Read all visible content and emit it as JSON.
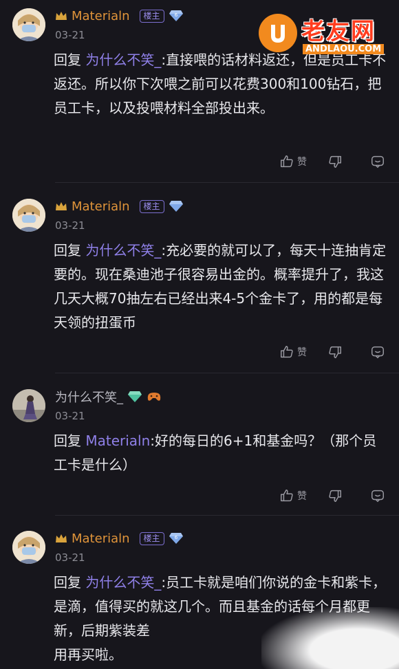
{
  "watermark": {
    "title": "老友网",
    "url": "ANDLAOU.COM"
  },
  "colors": {
    "background": "#17161c",
    "op_name": "#e0943a",
    "mention": "#8f80e8",
    "badge": "#9d8ff0"
  },
  "comments": [
    {
      "author": "Materialn",
      "is_op": true,
      "op_badge": "楼主",
      "level": "6",
      "date": "03-21",
      "reply_prefix": "回复 ",
      "reply_to": "为什么不笑_",
      "text": ":直接喂的话材料返还，但是员工卡不返还。所以你下次喂之前可以花费300和100钻石，把员工卡，以及投喂材料全部投出来。",
      "like_label": "赞"
    },
    {
      "author": "Materialn",
      "is_op": true,
      "op_badge": "楼主",
      "level": "",
      "date": "03-21",
      "reply_prefix": "回复 ",
      "reply_to": "为什么不笑_",
      "text": ":充必要的就可以了，每天十连抽肯定要的。现在桑迪池子很容易出金的。概率提升了，我这几天大概70抽左右已经出来4-5个金卡了，用的都是每天领的扭蛋币",
      "like_label": "赞"
    },
    {
      "author": "为什么不笑_",
      "is_op": false,
      "date": "03-21",
      "reply_prefix": "回复 ",
      "reply_to": "Materialn",
      "text": ":好的每日的6+1和基金吗？（那个员工卡是什么）",
      "like_label": "赞"
    },
    {
      "author": "Materialn",
      "is_op": true,
      "op_badge": "楼主",
      "level": "6",
      "date": "03-21",
      "reply_prefix": "回复 ",
      "reply_to": "为什么不笑_",
      "text": ":员工卡就是咱们你说的金卡和紫卡，是滴，值得买的就这几个。而且基金的话每个月都更新，后期紫装差",
      "text_tail": "用再买啦。",
      "like_label": "赞"
    }
  ]
}
